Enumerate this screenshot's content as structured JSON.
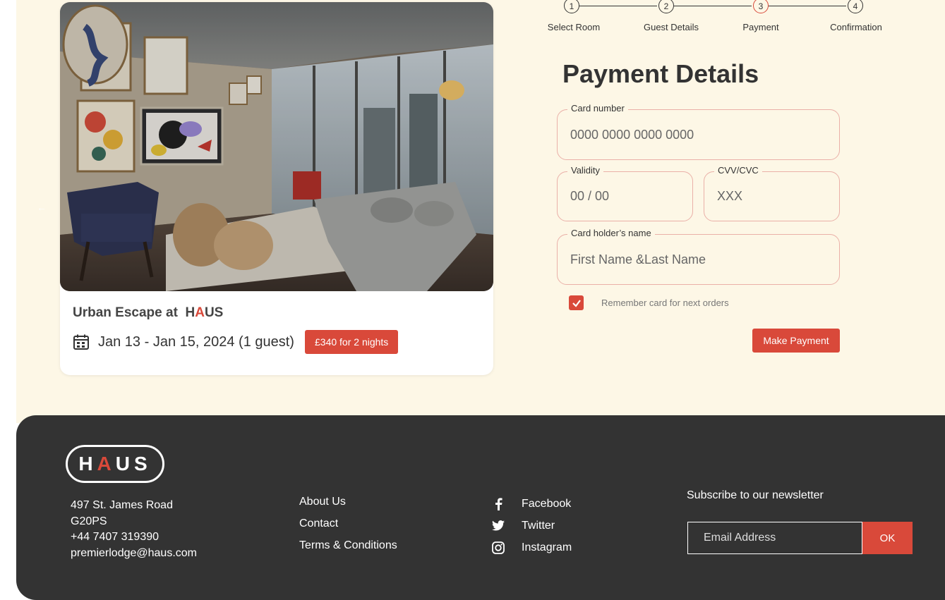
{
  "stepper": {
    "steps": [
      {
        "number": "1",
        "label": "Select Room"
      },
      {
        "number": "2",
        "label": "Guest Details"
      },
      {
        "number": "3",
        "label": "Payment"
      },
      {
        "number": "4",
        "label": "Confirmation"
      }
    ],
    "active_step": 3
  },
  "room": {
    "title_prefix": "Urban Escape at",
    "brand_h": "H",
    "brand_a": "A",
    "brand_us": "US",
    "dates": "Jan 13 - Jan 15, 2024 (1 guest)",
    "price": "£340 for 2 nights"
  },
  "payment": {
    "title": "Payment Details",
    "card_number_label": "Card number",
    "card_number_placeholder": "0000 0000 0000 0000",
    "validity_label": "Validity",
    "validity_placeholder": "00 / 00",
    "cvv_label": "CVV/CVC",
    "cvv_placeholder": "XXX",
    "holder_label": "Card holder’s name",
    "holder_placeholder": "First Name &Last Name",
    "remember_label": "Remember card for next orders",
    "remember_checked": true,
    "submit_label": "Make Payment"
  },
  "footer": {
    "logo_h": "H",
    "logo_a": "A",
    "logo_us": "US",
    "address": [
      "497 St. James Road",
      "G20PS",
      "+44 7407 319390",
      "premierlodge@haus.com"
    ],
    "links": [
      "About Us",
      "Contact",
      "Terms & Conditions"
    ],
    "social": [
      {
        "icon": "facebook-icon",
        "label": "Facebook"
      },
      {
        "icon": "twitter-icon",
        "label": "Twitter"
      },
      {
        "icon": "instagram-icon",
        "label": "Instagram"
      }
    ],
    "newsletter_title": "Subscribe to our newsletter",
    "newsletter_placeholder": "Email Address",
    "newsletter_button": "OK"
  },
  "colors": {
    "accent": "#d9493a",
    "page_bg": "#fdf7e6",
    "footer_bg": "#333333"
  }
}
